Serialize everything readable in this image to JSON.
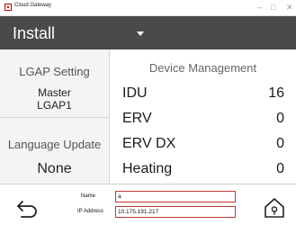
{
  "window": {
    "title": "Cloud Gateway",
    "minimize": "–",
    "maximize": "□",
    "close": "✕"
  },
  "header": {
    "menu_value": "Install"
  },
  "left_panel": {
    "lgap_title": "LGAP Setting",
    "lgap_value_line1": "Master",
    "lgap_value_line2": "LGAP1",
    "language_title": "Language Update",
    "language_value": "None"
  },
  "device_management": {
    "title": "Device Management",
    "rows": [
      {
        "name": "IDU",
        "count": "16"
      },
      {
        "name": "ERV",
        "count": "0"
      },
      {
        "name": "ERV DX",
        "count": "0"
      },
      {
        "name": "Heating",
        "count": "0"
      }
    ]
  },
  "footer": {
    "name_label": "Name",
    "name_value": "a",
    "ip_label": "IP Address",
    "ip_value": "10.175.191.217"
  },
  "colors": {
    "header_bg": "#4a4a4a",
    "field_border": "#c0392b",
    "accent_red": "#c00000"
  },
  "icons": {
    "back": "back-arrow-icon",
    "home": "home-icon"
  }
}
